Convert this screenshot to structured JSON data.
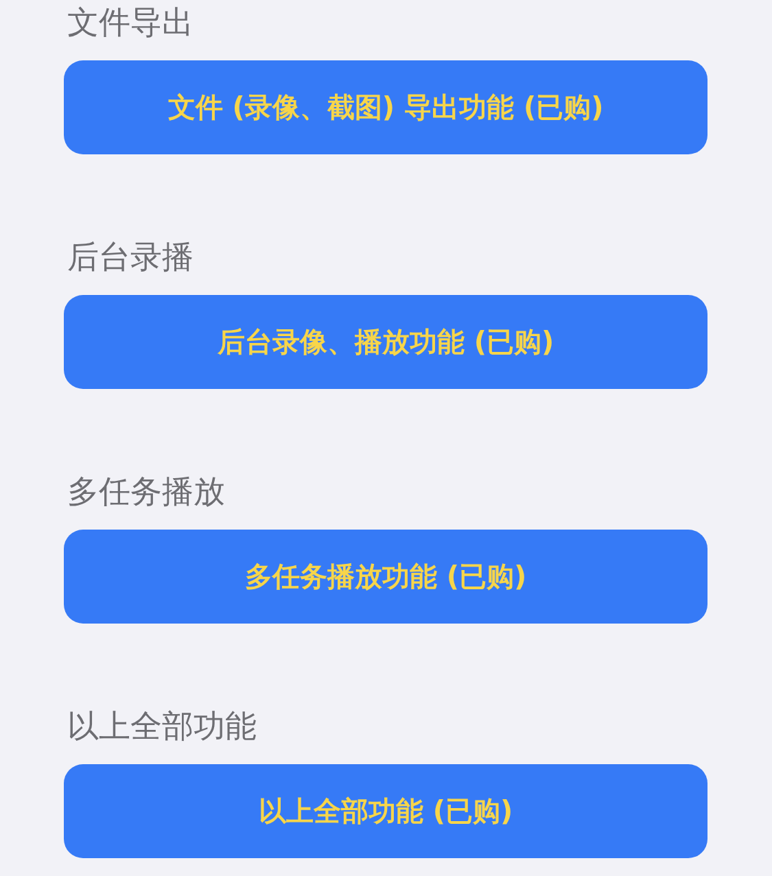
{
  "sections": [
    {
      "title": "文件导出",
      "button": "文件 (录像、截图) 导出功能 (已购)"
    },
    {
      "title": "后台录播",
      "button": "后台录像、播放功能 (已购)"
    },
    {
      "title": "多任务播放",
      "button": "多任务播放功能 (已购)"
    },
    {
      "title": "以上全部功能",
      "button": "以上全部功能 (已购)"
    }
  ]
}
